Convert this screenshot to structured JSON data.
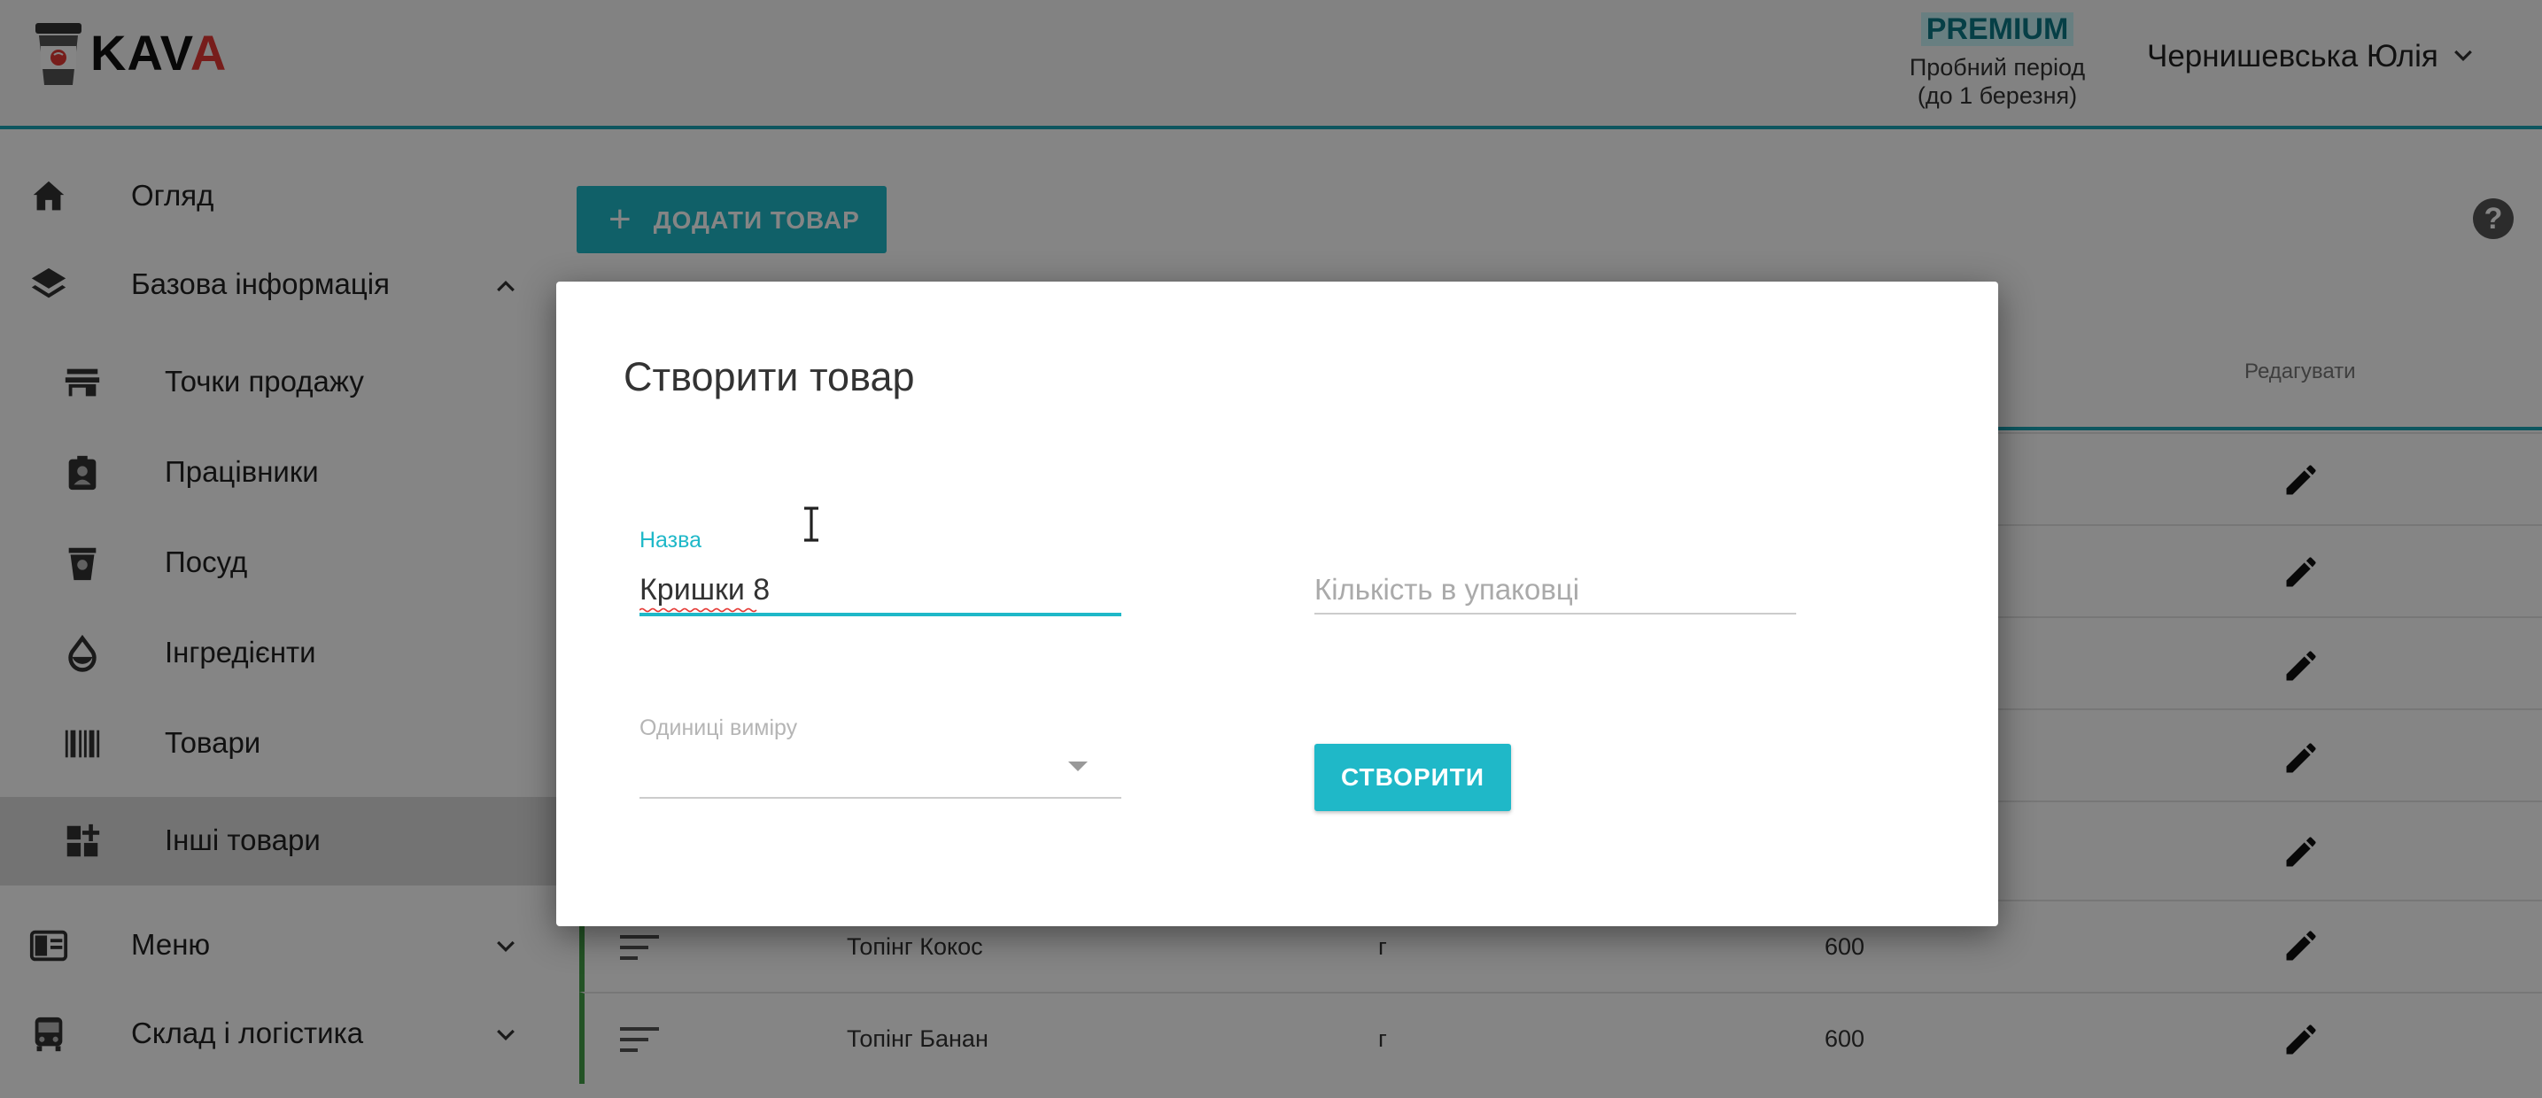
{
  "header": {
    "logo_text_main": "KAV",
    "logo_text_accent": "A",
    "plan": "PREMIUM",
    "trial_line1": "Пробний період",
    "trial_line2": "(до 1 березня)",
    "user_name": "Чернишевська Юлія"
  },
  "sidebar": {
    "items": [
      {
        "label": "Огляд",
        "icon": "home-icon"
      },
      {
        "label": "Базова інформація",
        "icon": "layers-icon",
        "expanded": true
      },
      {
        "label": "Точки продажу",
        "icon": "store-icon"
      },
      {
        "label": "Працівники",
        "icon": "badge-icon"
      },
      {
        "label": "Посуд",
        "icon": "cup-icon"
      },
      {
        "label": "Інгредієнти",
        "icon": "drop-icon"
      },
      {
        "label": "Товари",
        "icon": "barcode-icon"
      },
      {
        "label": "Інші товари",
        "icon": "dashboard-add-icon",
        "active": true
      },
      {
        "label": "Меню",
        "icon": "menu-book-icon",
        "expanded": false
      },
      {
        "label": "Склад і логістика",
        "icon": "bus-icon",
        "expanded": false
      }
    ]
  },
  "main": {
    "add_button": "ДОДАТИ ТОВАР",
    "help_glyph": "?",
    "table": {
      "edit_header": "Редагувати",
      "rows": [
        {
          "name": "Топінг Кокос",
          "unit": "г",
          "qty": "600"
        },
        {
          "name": "Топінг Банан",
          "unit": "г",
          "qty": "600"
        }
      ]
    }
  },
  "dialog": {
    "title": "Створити товар",
    "name_label": "Назва",
    "name_value": "Кришки 8",
    "qty_placeholder": "Кількість в упаковці",
    "unit_label": "Одиниці виміру",
    "unit_value": "",
    "create_button": "СТВОРИТИ"
  },
  "colors": {
    "accent": "#1fb8c8",
    "row_marker": "#43a047",
    "active_sidebar_bg": "#dcdcdc"
  }
}
